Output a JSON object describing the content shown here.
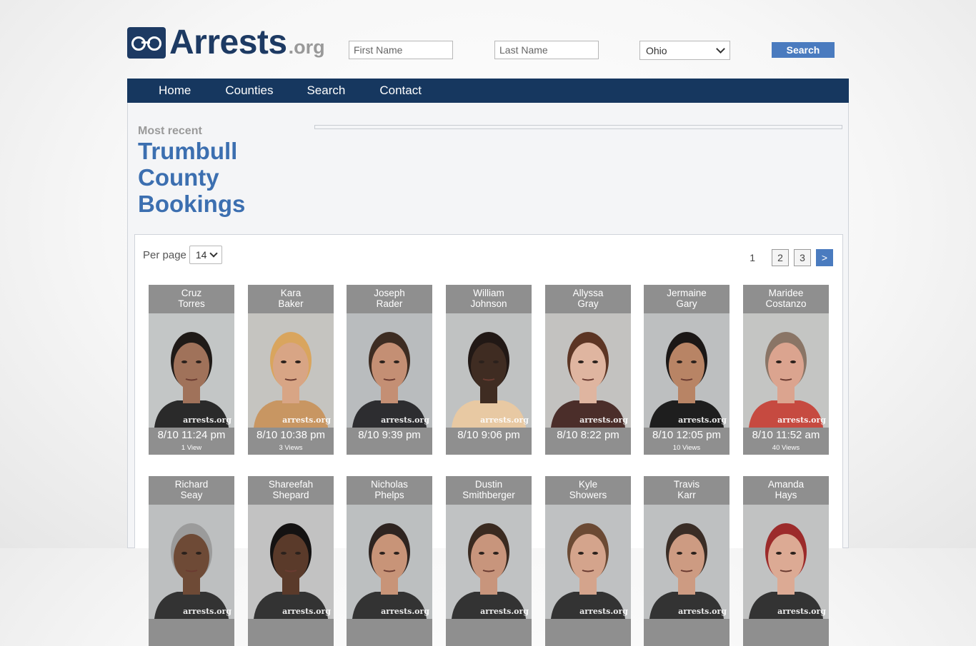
{
  "header": {
    "logo_word": "Arrests",
    "logo_suffix": ".org",
    "first_name_placeholder": "First Name",
    "last_name_placeholder": "Last Name",
    "state_selected": "Ohio",
    "search_label": "Search"
  },
  "nav": {
    "items": [
      "Home",
      "Counties",
      "Search",
      "Contact"
    ]
  },
  "page": {
    "kicker": "Most recent",
    "title": "Trumbull County Bookings",
    "per_page_label": "Per page",
    "per_page_value": "14"
  },
  "pagination": {
    "current": "1",
    "pages": [
      "2",
      "3"
    ],
    "next": ">"
  },
  "watermark": "arrests.org",
  "bookings": [
    {
      "first": "Cruz",
      "last": "Torres",
      "date": "8/10 11:24 pm",
      "views": "1 View",
      "skin": "#a0725a",
      "hair": "#1f1a17",
      "shirt": "#2a2a2a",
      "bg": "#c3c6c6"
    },
    {
      "first": "Kara",
      "last": "Baker",
      "date": "8/10 10:38 pm",
      "views": "3 Views",
      "skin": "#d8a585",
      "hair": "#d9a55e",
      "shirt": "#c89662",
      "bg": "#c5c4c0"
    },
    {
      "first": "Joseph",
      "last": "Rader",
      "date": "8/10 9:39 pm",
      "views": "",
      "skin": "#c48f74",
      "hair": "#3d2c22",
      "shirt": "#2d2d30",
      "bg": "#b9bcbe"
    },
    {
      "first": "William",
      "last": "Johnson",
      "date": "8/10 9:06 pm",
      "views": "",
      "skin": "#3f2c22",
      "hair": "#211815",
      "shirt": "#e8c9a3",
      "bg": "#c0c2c2"
    },
    {
      "first": "Allyssa",
      "last": "Gray",
      "date": "8/10 8:22 pm",
      "views": "",
      "skin": "#dfb5a0",
      "hair": "#5c3524",
      "shirt": "#4b2e2a",
      "bg": "#c3c2c0"
    },
    {
      "first": "Jermaine",
      "last": "Gary",
      "date": "8/10 12:05 pm",
      "views": "10 Views",
      "skin": "#b88465",
      "hair": "#1b1716",
      "shirt": "#1e1e1e",
      "bg": "#bdbfc0"
    },
    {
      "first": "Maridee",
      "last": "Costanzo",
      "date": "8/10 11:52 am",
      "views": "40 Views",
      "skin": "#dba48f",
      "hair": "#8a7566",
      "shirt": "#c64a40",
      "bg": "#c4c5c3"
    },
    {
      "first": "Richard",
      "last": "Seay",
      "date": "",
      "views": "",
      "skin": "#6e4a36",
      "hair": "#9b9b9b",
      "shirt": "#333",
      "bg": "#bdbfc0"
    },
    {
      "first": "Shareefah",
      "last": "Shepard",
      "date": "",
      "views": "",
      "skin": "#5a3a2a",
      "hair": "#141212",
      "shirt": "#333",
      "bg": "#c2c2c2"
    },
    {
      "first": "Nicholas",
      "last": "Phelps",
      "date": "",
      "views": "",
      "skin": "#c89478",
      "hair": "#2e2420",
      "shirt": "#333",
      "bg": "#bcbfc0"
    },
    {
      "first": "Dustin",
      "last": "Smithberger",
      "date": "",
      "views": "",
      "skin": "#c8957c",
      "hair": "#3a2a20",
      "shirt": "#333",
      "bg": "#c0c2c3"
    },
    {
      "first": "Kyle",
      "last": "Showers",
      "date": "",
      "views": "",
      "skin": "#d4a48c",
      "hair": "#6b4a34",
      "shirt": "#333",
      "bg": "#bfc1c2"
    },
    {
      "first": "Travis",
      "last": "Karr",
      "date": "",
      "views": "",
      "skin": "#cd9b82",
      "hair": "#3a2d26",
      "shirt": "#333",
      "bg": "#bec0c1"
    },
    {
      "first": "Amanda",
      "last": "Hays",
      "date": "",
      "views": "",
      "skin": "#dcaa94",
      "hair": "#9c2b2b",
      "shirt": "#333",
      "bg": "#c1c2c2"
    }
  ]
}
